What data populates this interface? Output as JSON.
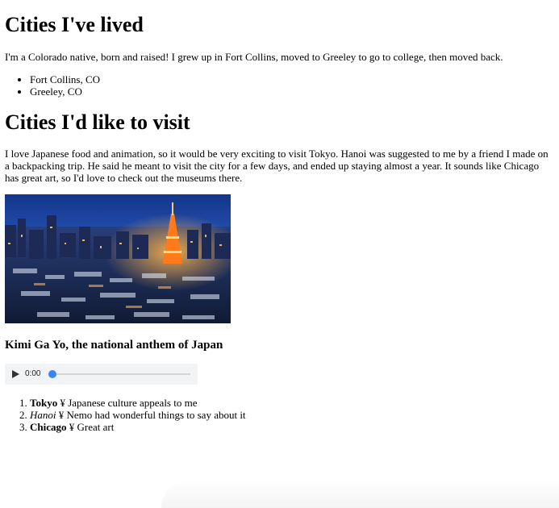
{
  "section_lived": {
    "heading": "Cities I've lived",
    "intro": "I'm a Colorado native, born and raised! I grew up in Fort Collins, moved to Greeley to go to college, then moved back.",
    "cities": [
      "Fort Collins, CO",
      "Greeley, CO"
    ]
  },
  "section_visit": {
    "heading": "Cities I'd like to visit",
    "intro": "I love Japanese food and animation, so it would be very exciting to visit Tokyo. Hanoi was suggested to me by a friend I made on a backpacking trip. He said he meant to visit the city for a few days, and ended up staying almost a year. It sounds like Chicago has great art, so I'd love to check out the museums there.",
    "image_subject": "Tokyo skyline at night with illuminated tower",
    "audio_title": "Kimi Ga Yo, the national anthem of Japan",
    "audio": {
      "time": "0:00",
      "progress": 0
    },
    "list": [
      {
        "city": "Tokyo",
        "sep": " ¥ ",
        "reason": "Japanese culture appeals to me",
        "style": "bold"
      },
      {
        "city": "Hanoi",
        "sep": " ¥ ",
        "reason": "Nemo had wonderful things to say about it",
        "style": "italic"
      },
      {
        "city": "Chicago",
        "sep": " ¥ ",
        "reason": "Great art",
        "style": "bold"
      }
    ]
  },
  "colors": {
    "audio_bg": "#f1f3f4",
    "audio_thumb": "#3e84f5",
    "sky_top": "#1b3f8f",
    "tower": "#ff7a1a"
  },
  "icons": {
    "play": "play-icon"
  }
}
